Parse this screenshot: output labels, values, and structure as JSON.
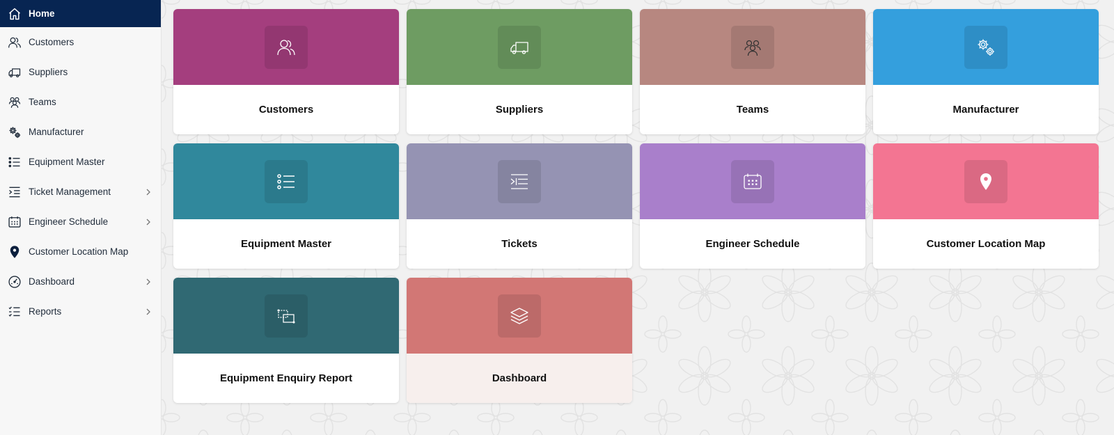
{
  "sidebar": {
    "items": [
      {
        "label": "Home",
        "icon": "home-icon",
        "active": true,
        "submenu": false
      },
      {
        "label": "Customers",
        "icon": "users-icon",
        "active": false,
        "submenu": false
      },
      {
        "label": "Suppliers",
        "icon": "truck-icon",
        "active": false,
        "submenu": false
      },
      {
        "label": "Teams",
        "icon": "team-icon",
        "active": false,
        "submenu": false
      },
      {
        "label": "Manufacturer",
        "icon": "gear-icon",
        "active": false,
        "submenu": false
      },
      {
        "label": "Equipment Master",
        "icon": "list-icon",
        "active": false,
        "submenu": false
      },
      {
        "label": "Ticket Management",
        "icon": "indent-list-icon",
        "active": false,
        "submenu": true
      },
      {
        "label": "Engineer Schedule",
        "icon": "calendar-icon",
        "active": false,
        "submenu": true
      },
      {
        "label": "Customer Location Map",
        "icon": "map-pin-icon",
        "active": false,
        "submenu": false
      },
      {
        "label": "Dashboard",
        "icon": "gauge-icon",
        "active": false,
        "submenu": true
      },
      {
        "label": "Reports",
        "icon": "checklist-icon",
        "active": false,
        "submenu": true
      }
    ]
  },
  "tiles": [
    {
      "label": "Customers",
      "color": "#a43e7e",
      "icon": "users-icon"
    },
    {
      "label": "Suppliers",
      "color": "#6e9c62",
      "icon": "truck-icon"
    },
    {
      "label": "Teams",
      "color": "#b78780",
      "icon": "team-icon"
    },
    {
      "label": "Manufacturer",
      "color": "#349fdd",
      "icon": "gear-icon"
    },
    {
      "label": "Equipment Master",
      "color": "#30889c",
      "icon": "list-icon"
    },
    {
      "label": "Tickets",
      "color": "#9593b3",
      "icon": "indent-list-icon"
    },
    {
      "label": "Engineer Schedule",
      "color": "#a97fcb",
      "icon": "calendar-icon"
    },
    {
      "label": "Customer Location Map",
      "color": "#f37592",
      "icon": "map-pin-icon"
    },
    {
      "label": "Equipment Enquiry Report",
      "color": "#306973",
      "icon": "report-icon"
    },
    {
      "label": "Dashboard",
      "color": "#d27775",
      "icon": "layers-icon"
    }
  ],
  "colors": {
    "sidebar_active": "#072552",
    "sidebar_bg": "#f7f7f7",
    "page_bg": "#f1f1f1"
  }
}
